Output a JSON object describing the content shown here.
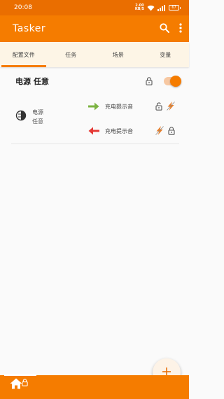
{
  "status_bar": {
    "time": "20:08",
    "speed_value": "2.00",
    "speed_unit": "KB/S",
    "battery": "67"
  },
  "app_bar": {
    "title": "Tasker",
    "icons": [
      "search-icon",
      "more-vert-icon"
    ]
  },
  "tabs": [
    {
      "label": "配置文件",
      "active": true
    },
    {
      "label": "任务",
      "active": false
    },
    {
      "label": "场景",
      "active": false
    },
    {
      "label": "变量",
      "active": false
    }
  ],
  "profile": {
    "name": "电源 任意",
    "enabled": true,
    "context": {
      "icon": "power-icon",
      "label": "电源 任意"
    },
    "tasks": [
      {
        "direction": "enter",
        "name": "充电提示音",
        "arrow_color": "#7cb342"
      },
      {
        "direction": "exit",
        "name": "充电提示音",
        "arrow_color": "#e53935"
      }
    ]
  },
  "fab": {
    "icon": "plus-icon"
  },
  "bottom_bar": {
    "icon": "home-icon"
  },
  "colors": {
    "primary": "#f57c00",
    "status_bar": "#ea6e00",
    "tab_background": "#fdf5e6"
  }
}
